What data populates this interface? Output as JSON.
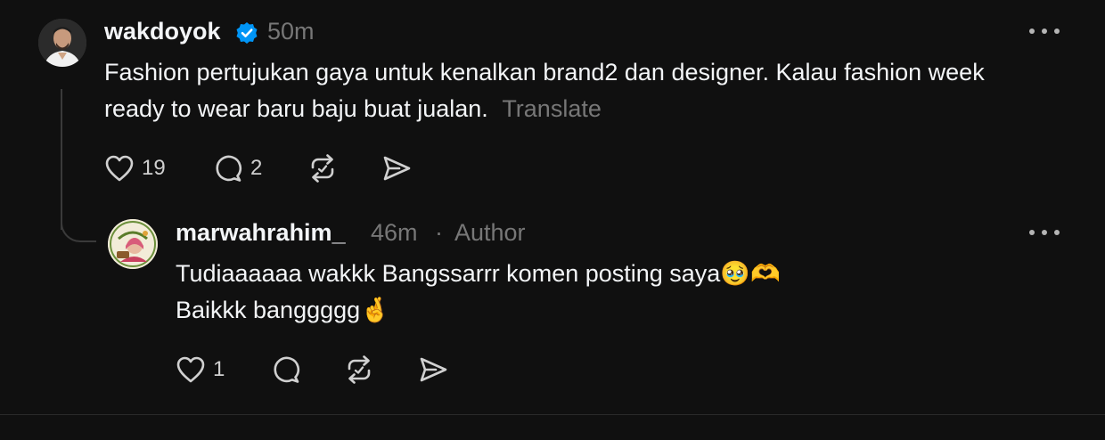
{
  "post": {
    "username": "wakdoyok",
    "time": "50m",
    "text": "Fashion pertujukan gaya untuk kenalkan brand2 dan designer. Kalau fashion week ready to wear baru baju buat jualan.",
    "translate_label": "Translate",
    "like_count": "19",
    "reply_count": "2",
    "icons": [
      "verified-badge-icon",
      "more-icon",
      "heart-icon",
      "comment-icon",
      "repost-icon",
      "share-icon"
    ]
  },
  "reply": {
    "username": "marwahrahim_",
    "time": "46m",
    "separator": "·",
    "author_label": "Author",
    "line1": "Tudiaaaaaa wakkk Bangssarrr komen posting saya🥹🫶",
    "line2": "Baikkk banggggg🤞",
    "like_count": "1",
    "icons": [
      "more-icon",
      "heart-icon",
      "comment-icon",
      "repost-icon",
      "share-icon"
    ]
  },
  "colors": {
    "background": "#101010",
    "text": "#f3f5f7",
    "muted": "#777777",
    "verified": "#0095f6",
    "thread_line": "#3a3a3a"
  }
}
